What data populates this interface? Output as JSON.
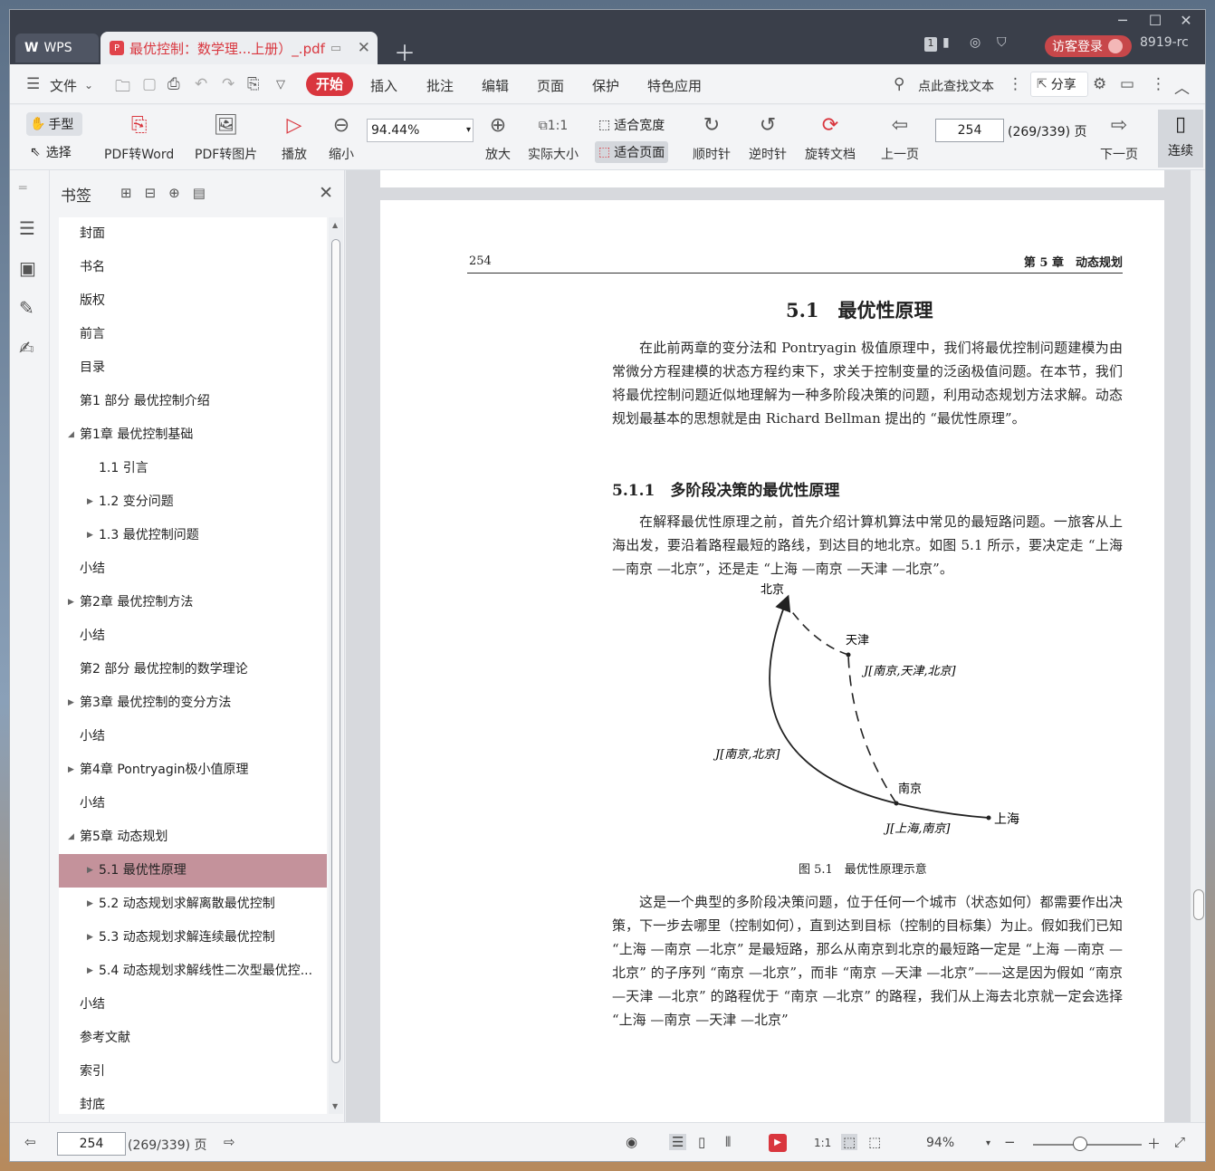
{
  "titlebar": {
    "app_label": "WPS",
    "doc_tab": "最优控制：数学理...上册）_.pdf",
    "tab_count": "1",
    "login": "访客登录",
    "user_id": "8919-rc"
  },
  "menu": {
    "file": "文件",
    "items": [
      "开始",
      "插入",
      "批注",
      "编辑",
      "页面",
      "保护",
      "特色应用"
    ],
    "search": "点此查找文本",
    "share": "分享"
  },
  "toolbar": {
    "hand": "手型",
    "select": "选择",
    "pdf_to_word": "PDF转Word",
    "pdf_to_image": "PDF转图片",
    "play": "播放",
    "zoom_out": "缩小",
    "zoom_value": "94.44%",
    "zoom_in": "放大",
    "actual_size": "实际大小",
    "fit_width": "适合宽度",
    "fit_page": "适合页面",
    "rotate_cw": "顺时针",
    "rotate_ccw": "逆时针",
    "rotate_doc": "旋转文档",
    "prev_page": "上一页",
    "page_input": "254",
    "page_total": "(269/339) 页",
    "next_page": "下一页",
    "continuous": "连续"
  },
  "bookmarks": {
    "title": "书签",
    "items": [
      {
        "label": "封面",
        "level": 0,
        "arrow": ""
      },
      {
        "label": "书名",
        "level": 0,
        "arrow": ""
      },
      {
        "label": "版权",
        "level": 0,
        "arrow": ""
      },
      {
        "label": "前言",
        "level": 0,
        "arrow": ""
      },
      {
        "label": "目录",
        "level": 0,
        "arrow": ""
      },
      {
        "label": "第1 部分 最优控制介绍",
        "level": 0,
        "arrow": ""
      },
      {
        "label": "第1章 最优控制基础",
        "level": 0,
        "arrow": "down"
      },
      {
        "label": "1.1 引言",
        "level": 1,
        "arrow": ""
      },
      {
        "label": "1.2 变分问题",
        "level": 1,
        "arrow": "right"
      },
      {
        "label": "1.3 最优控制问题",
        "level": 1,
        "arrow": "right"
      },
      {
        "label": "小结",
        "level": 0,
        "arrow": ""
      },
      {
        "label": "第2章 最优控制方法",
        "level": 0,
        "arrow": "right"
      },
      {
        "label": "小结",
        "level": 0,
        "arrow": ""
      },
      {
        "label": "第2 部分 最优控制的数学理论",
        "level": 0,
        "arrow": ""
      },
      {
        "label": "第3章 最优控制的变分方法",
        "level": 0,
        "arrow": "right"
      },
      {
        "label": "小结",
        "level": 0,
        "arrow": ""
      },
      {
        "label": "第4章 Pontryagin极小值原理",
        "level": 0,
        "arrow": "right"
      },
      {
        "label": "小结",
        "level": 0,
        "arrow": ""
      },
      {
        "label": "第5章 动态规划",
        "level": 0,
        "arrow": "down"
      },
      {
        "label": "5.1 最优性原理",
        "level": 1,
        "arrow": "right",
        "selected": true
      },
      {
        "label": "5.2 动态规划求解离散最优控制",
        "level": 1,
        "arrow": "right"
      },
      {
        "label": "5.3 动态规划求解连续最优控制",
        "level": 1,
        "arrow": "right"
      },
      {
        "label": "5.4 动态规划求解线性二次型最优控...",
        "level": 1,
        "arrow": "right"
      },
      {
        "label": "小结",
        "level": 0,
        "arrow": ""
      },
      {
        "label": "参考文献",
        "level": 0,
        "arrow": ""
      },
      {
        "label": "索引",
        "level": 0,
        "arrow": ""
      },
      {
        "label": "封底",
        "level": 0,
        "arrow": ""
      }
    ]
  },
  "page": {
    "number": "254",
    "chapter": "第 5 章　动态规划",
    "section_title": "5.1　最优性原理",
    "para1": "在此前两章的变分法和 Pontryagin 极值原理中，我们将最优控制问题建模为由常微分方程建模的状态方程约束下，求关于控制变量的泛函极值问题。在本节，我们将最优控制问题近似地理解为一种多阶段决策的问题，利用动态规划方法求解。动态规划最基本的思想就是由 Richard Bellman 提出的 “最优性原理”。",
    "subsection": "5.1.1　多阶段决策的最优性原理",
    "para2": "在解释最优性原理之前，首先介绍计算机算法中常见的最短路问题。一旅客从上海出发，要沿着路程最短的路线，到达目的地北京。如图 5.1 所示，要决定走 “上海 —南京 —北京”，还是走 “上海 —南京 —天津 —北京”。",
    "figure": {
      "beijing": "北京",
      "tianjin": "天津",
      "nanjing": "南京",
      "shanghai": "上海",
      "j_ntb": "J[南京,天津,北京]",
      "j_nb": "J[南京,北京]",
      "j_sn": "J[上海,南京]",
      "caption": "图 5.1　最优性原理示意"
    },
    "para3": "这是一个典型的多阶段决策问题，位于任何一个城市（状态如何）都需要作出决策，下一步去哪里（控制如何），直到达到目标（控制的目标集）为止。假如我们已知 “上海 —南京 —北京” 是最短路，那么从南京到北京的最短路一定是 “上海 —南京 —北京” 的子序列 “南京 —北京”，而非 “南京 —天津 —北京”——这是因为假如 “南京 —天津 —北京” 的路程优于 “南京 —北京” 的路程，我们从上海去北京就一定会选择 “上海 —南京 —天津 —北京”"
  },
  "status": {
    "page_input": "254",
    "page_total": "(269/339) 页",
    "zoom": "94%"
  },
  "colors": {
    "accent": "#d9363e",
    "selected_bookmark": "#c4929b",
    "titlebar": "#3a3f4a"
  }
}
